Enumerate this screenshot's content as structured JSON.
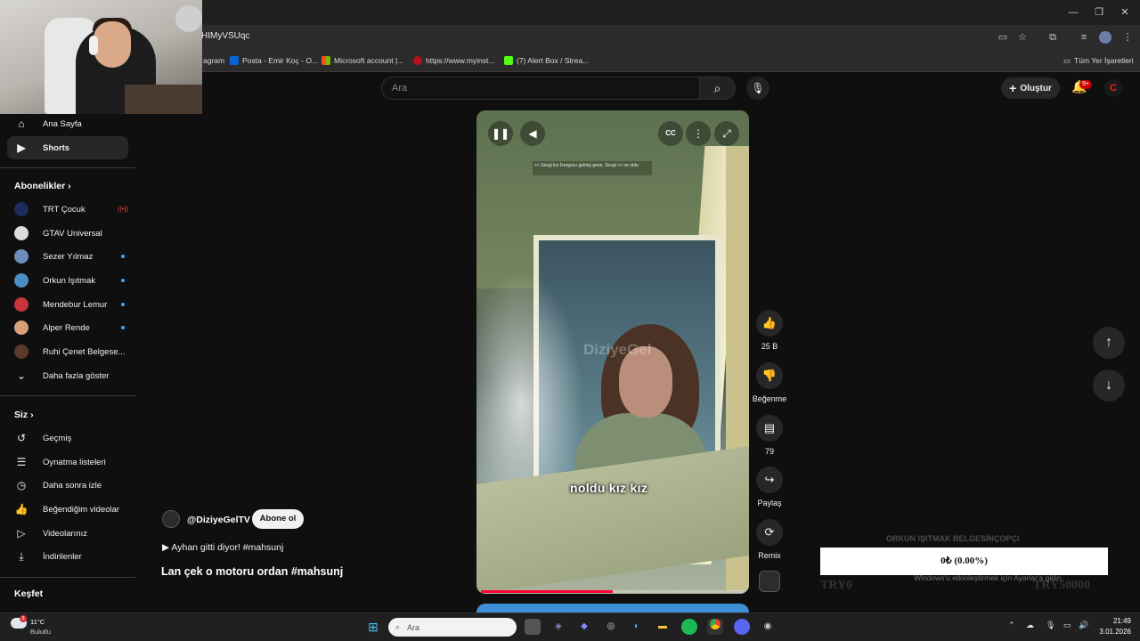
{
  "browser": {
    "url_fragment": "HIMyVSUqc",
    "bookmarks": [
      {
        "label": "agram",
        "color": "#c13584"
      },
      {
        "label": "Posta - Emir Koç - O...",
        "color": "#0a64d6"
      },
      {
        "label": "Microsoft account |...",
        "color": "#f25022"
      },
      {
        "label": "https://www.myinst...",
        "color": "#b5121b"
      },
      {
        "label": "(7) Alert Box / Strea...",
        "color": "#53fc18"
      }
    ],
    "all_bookmarks": "Tüm Yer İşaretleri"
  },
  "youtube": {
    "search_placeholder": "Ara",
    "create_label": "Oluştur",
    "notification_count": "9+"
  },
  "sidebar": {
    "items": [
      {
        "label": "Ana Sayfa",
        "icon": "home-icon"
      },
      {
        "label": "Shorts",
        "icon": "shorts-icon",
        "active": true
      }
    ],
    "subscriptions_title": "Abonelikler",
    "subscriptions": [
      {
        "label": "TRT Çocuk",
        "color": "#1f2b5a",
        "live": true
      },
      {
        "label": "GTAV Universal",
        "color": "#dcdcdc"
      },
      {
        "label": "Sezer Yılmaz",
        "color": "#6b8fb8",
        "new": true
      },
      {
        "label": "Orkun Işıtmak",
        "color": "#4a8fc4",
        "new": true
      },
      {
        "label": "Mendebur Lemur",
        "color": "#c8343a",
        "new": true
      },
      {
        "label": "Alper Rende",
        "color": "#d8a07a",
        "new": true
      },
      {
        "label": "Ruhi Çenet Belgese...",
        "color": "#5a3a2a"
      }
    ],
    "show_more": "Daha fazla göster",
    "you_title": "Siz",
    "you_items": [
      {
        "label": "Geçmiş",
        "icon": "history-icon"
      },
      {
        "label": "Oynatma listeleri",
        "icon": "playlists-icon"
      },
      {
        "label": "Daha sonra izle",
        "icon": "watch-later-icon"
      },
      {
        "label": "Beğendiğim videolar",
        "icon": "liked-icon"
      },
      {
        "label": "Videolarınız",
        "icon": "your-videos-icon"
      },
      {
        "label": "İndirilenler",
        "icon": "downloads-icon"
      }
    ],
    "explore_title": "Keşfet"
  },
  "short": {
    "caption": "noldu kız kız",
    "top_subtitle": ">> Sevgi kız İzergocu gelmiş gene. Sevgi >> ne oldu",
    "watermark": "DiziyeGel",
    "channel": "@DiziyeGelTV",
    "subscribe": "Abone ol",
    "music": "Ayhan gitti diyor! #mahsunj",
    "title": "Lan çek o motoru ordan #mahsunj",
    "progress": 0.5,
    "actions": {
      "like_count": "25 B",
      "dislike_label": "Beğenme",
      "comment_count": "79",
      "share_label": "Paylaş",
      "remix_label": "Remix"
    }
  },
  "overlay": {
    "donation": "0₺ (0.00%)",
    "donation_title": "ORKUN IŞITMAK BELGESİNÇOPÇI",
    "goal_left": "TRY0",
    "goal_right": "TRY50000",
    "activate_windows": "Windows'u etkinleştirmek için Ayarlar'a gidin."
  },
  "taskbar": {
    "weather_temp": "11°C",
    "weather_desc": "Bulutlu",
    "weather_badge": "3",
    "search": "Ara",
    "time": "21:49",
    "date": "3.01.2026"
  }
}
